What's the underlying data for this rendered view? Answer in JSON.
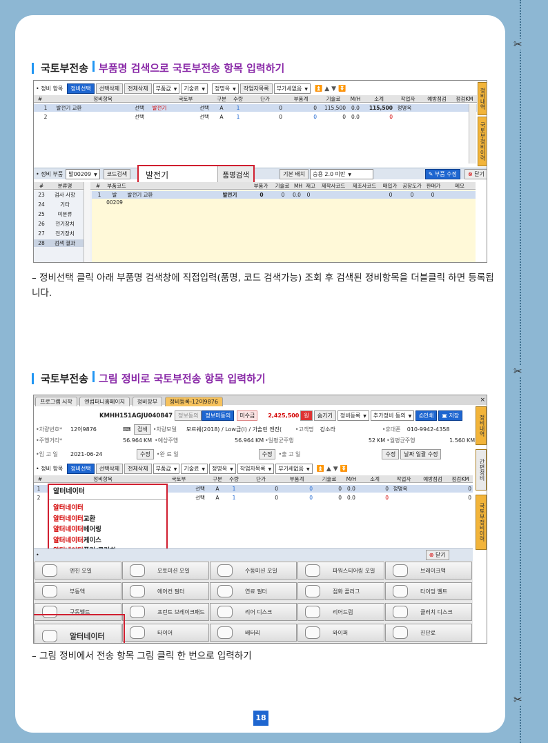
{
  "section1": {
    "title": "국토부전송",
    "subtitle": "부품명 검색으로 국토부전송 항목 입력하기",
    "toolbar": {
      "label": "• 정비 항목",
      "btn_select": "정비선택",
      "btn_del_sel": "선택삭제",
      "btn_del_all": "전체삭제",
      "dd1": "부품값",
      "dd2": "기술료",
      "dd3": "정명옥",
      "dd4": "작업자목록",
      "dd5": "부가세없음"
    },
    "grid_headers": [
      "#",
      "정비항목",
      "국토부",
      "구분",
      "수량",
      "단가",
      "부품계",
      "기술료",
      "M/H",
      "소계",
      "작업자",
      "예방점검",
      "점검KM"
    ],
    "rows": [
      {
        "no": "1",
        "item": "발전기 교환",
        "sel": "선택",
        "mol": "발전기",
        "sel2": "선택",
        "type": "A",
        "qty": "1",
        "price": "0",
        "parts": "0",
        "tech": "115,500",
        "mh": "0.0",
        "sub": "115,500",
        "worker": "정명옥",
        "km": "0"
      },
      {
        "no": "2",
        "item": "",
        "sel": "선택",
        "mol": "",
        "sel2": "선택",
        "type": "A",
        "qty": "1",
        "price": "0",
        "parts": "0",
        "tech": "0",
        "mh": "0.0",
        "sub": "0",
        "worker": "",
        "km": "0"
      }
    ],
    "side_tab1": "정비내역",
    "side_tab2": "국토부정비이력",
    "search_bar": {
      "label": "• 정비 부품",
      "code_value": "발00209",
      "code_btn": "코드검색",
      "popup_value": "발전기",
      "popup_btn": "품명검색",
      "basic_label": "기본 배치",
      "basic_value": "승용 2.0 미만",
      "save_btn": "부품 수정",
      "close_btn": "닫기"
    },
    "category_headers": [
      "#",
      "분류명"
    ],
    "categories": [
      {
        "no": "23",
        "name": "검사 사항"
      },
      {
        "no": "24",
        "name": "기타"
      },
      {
        "no": "25",
        "name": "미분류"
      },
      {
        "no": "26",
        "name": "전기장치"
      },
      {
        "no": "27",
        "name": "전기장치"
      },
      {
        "no": "28",
        "name": "검색 결과"
      }
    ],
    "parts_headers": [
      "#",
      "부품코드",
      "부품명",
      "규격",
      "국토부",
      "부품가",
      "기술료",
      "MH",
      "재고",
      "제작사코드",
      "제조사코드",
      "매입가",
      "공장도가",
      "판매가",
      "메모"
    ],
    "parts_row": {
      "no": "1",
      "code": "발00209",
      "name": "발전기 교환",
      "mol": "발전기",
      "price": "0",
      "tech": "0",
      "mh": "0.0",
      "stock": "0",
      "buy": "0",
      "factory": "0",
      "sell": "0"
    },
    "description": "– 정비선택 클릭 아래 부품명 검색창에 직접입력(품명, 코드 검색가능) 조회 후 검색된 정비항목을 더블클릭 하면 등록됩니다."
  },
  "section2": {
    "title": "국토부전송",
    "subtitle": "그림 정비로 국토부전송 항목 입력하기",
    "tabs": [
      "프로그램 시작",
      "엔컴퍼니홈페이지",
      "정비장부",
      "정비등록-12이9876"
    ],
    "info": {
      "car_no_id": "KMHH151AGJU040847",
      "btn_car_info": "정보동의",
      "btn_mobile": "정보미동의",
      "unpaid_label": "미수금",
      "unpaid_value": "2,425,500",
      "won": "원",
      "btn_hide": "숨기기",
      "dd_reg": "정비등록",
      "dd_add": "추가정비 동의",
      "btn_print": "인쇄",
      "btn_save": "저장",
      "car_no_label": "•차량번호*",
      "car_no": "12이9876",
      "btn_search": "검색",
      "model_label": "•차량모델",
      "model": "모르쉐(2018) / Low급(I) / 가솔린 엔진(",
      "customer_label": "•고객명",
      "customer": "강소라",
      "phone_label": "•휴대폰",
      "phone": "010-9942-4358",
      "dist_label": "•주행거리*",
      "dist": "56.964",
      "km": "KM",
      "expect_label": "•예상주행",
      "expect": "56.964",
      "avg_label": "•일평균주행",
      "avg": "52",
      "month_label": "•월평균주행",
      "month": "1.560",
      "in_label": "•입 고 일",
      "in_date": "2021-06-24",
      "btn_edit": "수정",
      "done_label": "•완 료 일",
      "out_label": "•출 고 일",
      "btn_date_edit": "날짜 일괄 수정"
    },
    "toolbar": {
      "label": "• 정비 항목",
      "btn_select": "정비선택",
      "btn_del_sel": "선택삭제",
      "btn_del_all": "전체삭제",
      "dd1": "부품값",
      "dd2": "기술료",
      "dd3": "정명옥",
      "dd4": "작업자목록",
      "dd5": "부가세없음"
    },
    "grid_headers": [
      "#",
      "정비항목",
      "국토부",
      "구분",
      "수량",
      "단가",
      "부품계",
      "기술료",
      "M/H",
      "소계",
      "작업자",
      "예방점검",
      "점검KM"
    ],
    "rows": [
      {
        "no": "1",
        "sel": "선택",
        "type": "A",
        "qty": "1",
        "price": "0",
        "parts": "0",
        "tech": "0",
        "mh": "0.0",
        "sub": "0",
        "worker": "정명옥",
        "km": "0"
      },
      {
        "no": "2",
        "sel": "선택",
        "type": "A",
        "qty": "1",
        "price": "0",
        "parts": "0",
        "tech": "0",
        "mh": "0.0",
        "sub": "0",
        "worker": "",
        "km": "0"
      }
    ],
    "autocomplete": {
      "input": "알터네이터",
      "prefix": "알터네이터",
      "options": [
        "",
        "교환",
        "베어링",
        "케이스",
        "풀리/클러치"
      ]
    },
    "close_btn": "닫기",
    "side_tab1": "정비내역",
    "side_tab2": "간편정비",
    "side_tab3": "국토부정비이력",
    "pic_buttons": [
      [
        "엔진 오일",
        "오토미션 오일",
        "수동미션 오일",
        "파워스티어링 오일",
        "브레이크액"
      ],
      [
        "부동액",
        "에어컨 필터",
        "연료 필터",
        "점화 플러그",
        "타이밍 벨트"
      ],
      [
        "구동벨트",
        "프런트 브레이크패드",
        "리어 디스크",
        "리어드럼",
        "클러치 디스크"
      ],
      [
        "알터네이터",
        "타이어",
        "배터리",
        "와이퍼",
        "진단료"
      ]
    ],
    "description": "– 그림 정비에서 전송 항목 그림 클릭 한 번으로 입력하기"
  },
  "page_number": "18",
  "colors": {
    "accent_blue": "#1e66d0",
    "title_purple": "#8a2aa8",
    "highlight_red": "#d01e2f",
    "background": "#8db7d3"
  }
}
